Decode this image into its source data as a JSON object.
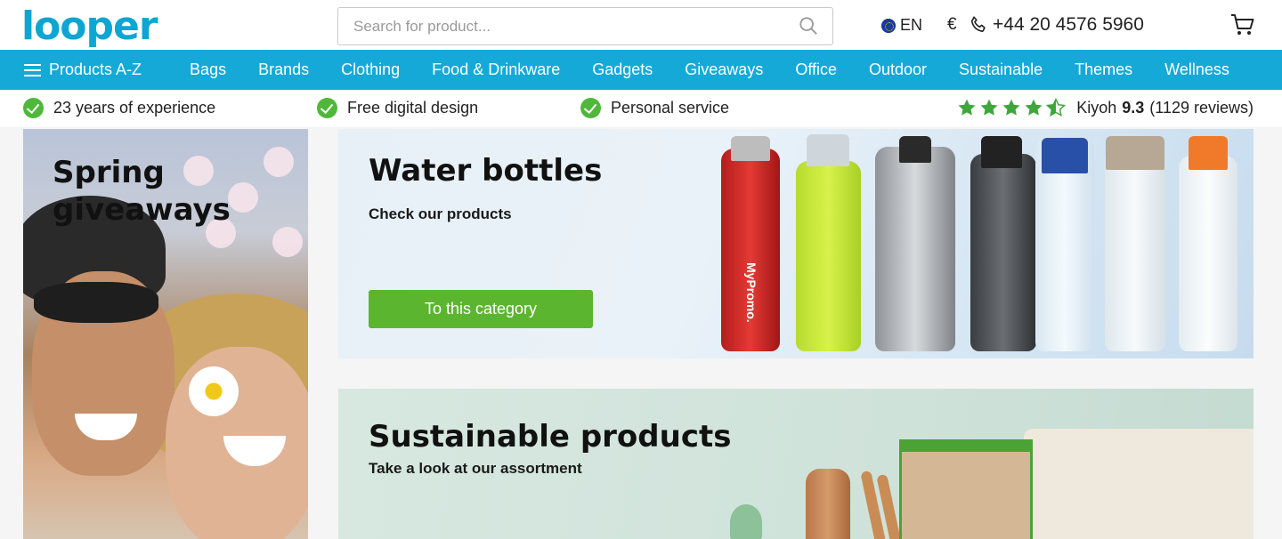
{
  "header": {
    "logo_text": "looper",
    "search_placeholder": "Search for product...",
    "language": "EN",
    "currency": "€",
    "phone": "+44 20 4576 5960"
  },
  "nav": {
    "menu_label": "Products A-Z",
    "items": [
      "Bags",
      "Brands",
      "Clothing",
      "Food & Drinkware",
      "Gadgets",
      "Giveaways",
      "Office",
      "Outdoor",
      "Sustainable",
      "Themes",
      "Wellness"
    ]
  },
  "usp": {
    "items": [
      "23 years of experience",
      "Free digital design",
      "Personal service"
    ],
    "rating_source": "Kiyoh",
    "rating_score": "9.3",
    "rating_reviews": "(1129 reviews)",
    "rating_stars": 4.5
  },
  "promo_side": {
    "title": "Spring giveaways"
  },
  "banner_water": {
    "title": "Water bottles",
    "subtitle": "Check our products",
    "cta": "To this category",
    "bottle_brand": "MyPromo."
  },
  "banner_sustainable": {
    "title": "Sustainable products",
    "subtitle": "Take a look at our assortment"
  },
  "colors": {
    "brand": "#0ea5d3",
    "nav": "#15a9d8",
    "accent_green": "#5cb52f",
    "check_green": "#4fb83a",
    "star_green": "#3ea63a"
  },
  "icons": [
    "search-icon",
    "globe-flag-icon",
    "phone-icon",
    "cart-icon",
    "hamburger-icon",
    "check-icon",
    "star-icon"
  ]
}
